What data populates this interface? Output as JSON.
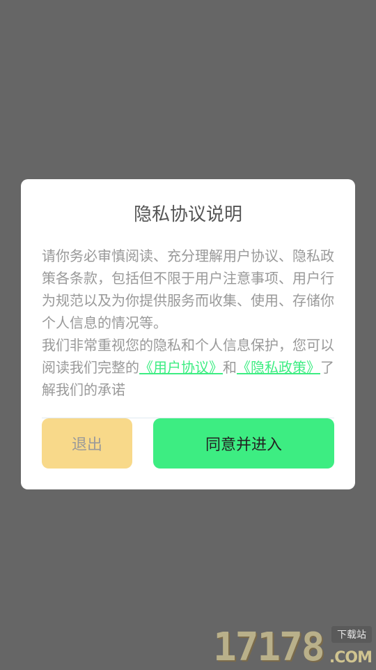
{
  "dialog": {
    "title": "隐私协议说明",
    "paragraph1": "请你务必审慎阅读、充分理解用户协议、隐私政策各条款，包括但不限于用户注意事项、用户行为规范以及为你提供服务而收集、使用、存储你个人信息的情况等。",
    "paragraph2_prefix": "我们非常重视您的隐私和个人信息保护，您可以阅读我们完整的",
    "user_agreement_link": "《用户协议》",
    "and_text": "和",
    "privacy_policy_link": "《隐私政策》",
    "paragraph2_suffix": "了解我们的承诺",
    "exit_label": "退出",
    "agree_label": "同意并进入"
  },
  "watermark": {
    "number": "17178",
    "tag": "下载站",
    "domain": ".COM"
  },
  "colors": {
    "overlay": "#666666",
    "accent_green": "#3ded82",
    "exit_button": "#f8d98a"
  }
}
